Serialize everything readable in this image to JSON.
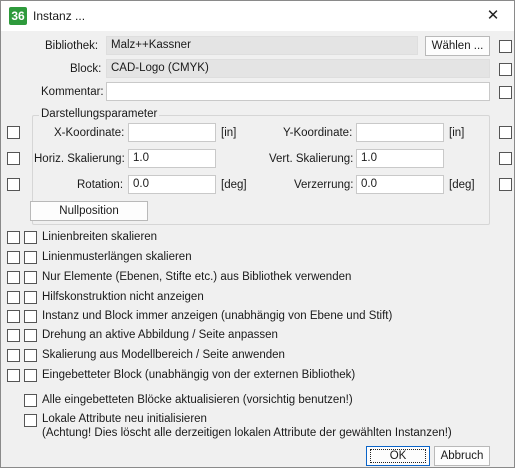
{
  "window": {
    "title": "Instanz ...",
    "app_icon_text": "36",
    "close_glyph": "✕"
  },
  "library": {
    "label": "Bibliothek:",
    "value": "Malz++Kassner",
    "choose_button": "Wählen ..."
  },
  "block": {
    "label": "Block:",
    "value": "CAD-Logo (CMYK)"
  },
  "comment": {
    "label": "Kommentar:",
    "value": ""
  },
  "display_params": {
    "group_title": "Darstellungsparameter",
    "x_label": "X-Koordinate:",
    "x_value": "",
    "x_unit": "[in]",
    "y_label": "Y-Koordinate:",
    "y_value": "",
    "y_unit": "[in]",
    "hscale_label": "Horiz. Skalierung:",
    "hscale_value": "1.0",
    "vscale_label": "Vert. Skalierung:",
    "vscale_value": "1.0",
    "rotation_label": "Rotation:",
    "rotation_value": "0.0",
    "rotation_unit": "[deg]",
    "skew_label": "Verzerrung:",
    "skew_value": "0.0",
    "skew_unit": "[deg]",
    "zero_button": "Nullposition"
  },
  "options": [
    "Linienbreiten skalieren",
    "Linienmusterlängen skalieren",
    "Nur Elemente (Ebenen, Stifte etc.) aus Bibliothek verwenden",
    "Hilfskonstruktion nicht anzeigen",
    "Instanz und Block immer anzeigen (unabhängig von Ebene und Stift)",
    "Drehung an aktive Abbildung / Seite anpassen",
    "Skalierung aus Modellbereich / Seite anwenden",
    "Eingebetteter Block (unabhängig von der externen Bibliothek)"
  ],
  "bottom_options": {
    "update_label": "Alle eingebetteten Blöcke aktualisieren (vorsichtig benutzen!)",
    "reset_label_line1": "Lokale Attribute neu initialisieren",
    "reset_label_line2": "(Achtung! Dies löscht alle derzeitigen lokalen Attribute der gewählten Instanzen!)"
  },
  "buttons": {
    "ok": "OK",
    "cancel": "Abbruch"
  }
}
